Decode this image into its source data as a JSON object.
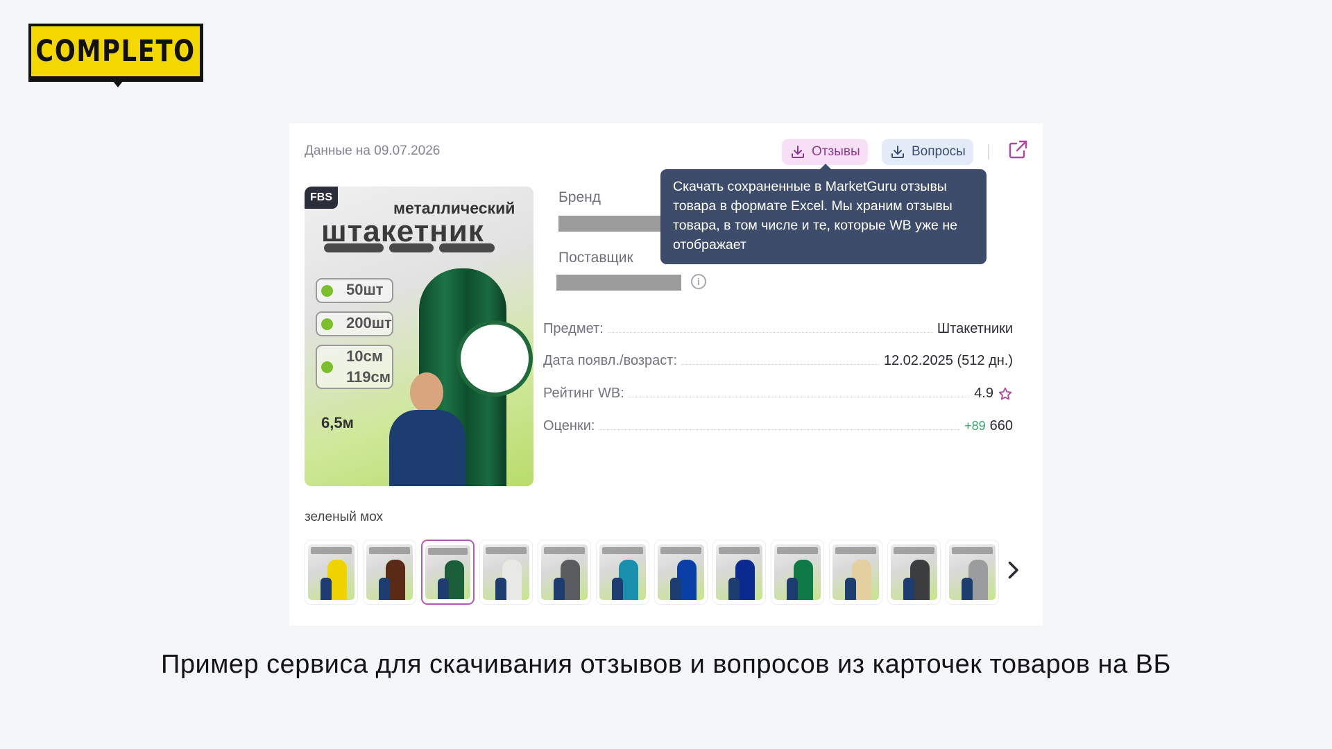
{
  "logo": {
    "text": "COMPLETO",
    "color": "#f2d800"
  },
  "card": {
    "date_text": "Данные на 09.07.2026",
    "buttons": {
      "reviews": "Отзывы",
      "questions": "Вопросы"
    },
    "tooltip": "Скачать сохраненные в MarketGuru отзывы товара в формате Excel. Мы храним отзывы товара, в том числе и те, которые WB уже не отображает",
    "badge": "FBS",
    "image_text": {
      "line1": "металлический",
      "line2": "штакетник",
      "b1": "50шт",
      "b2": "200шт",
      "b3": "10см",
      "b4": "119см",
      "bottom": "6,5м"
    },
    "brand_label": "Бренд",
    "supplier_label": "Поставщик",
    "details": [
      {
        "key": "Предмет:",
        "value": "Штакетники"
      },
      {
        "key": "Дата появл./возраст:",
        "value": "12.02.2025 (512 дн.)"
      },
      {
        "key": "Рейтинг WB:",
        "value": "4.9"
      },
      {
        "key": "Оценки:",
        "plus": "+89",
        "value": "660"
      }
    ],
    "color_name": "зеленый мох",
    "thumb_colors": [
      "#f0d400",
      "#5a2a16",
      "#1b5e3a",
      "#e8e8e4",
      "#5a5d5e",
      "#1a8fae",
      "#0b3fa8",
      "#0a2a8f",
      "#0f7a45",
      "#e4cfa0",
      "#3b3d3f",
      "#9a9c9e"
    ],
    "active_thumb_index": 2
  },
  "caption": "Пример сервиса для скачивания отзывов и вопросов из карточек товаров на ВБ"
}
